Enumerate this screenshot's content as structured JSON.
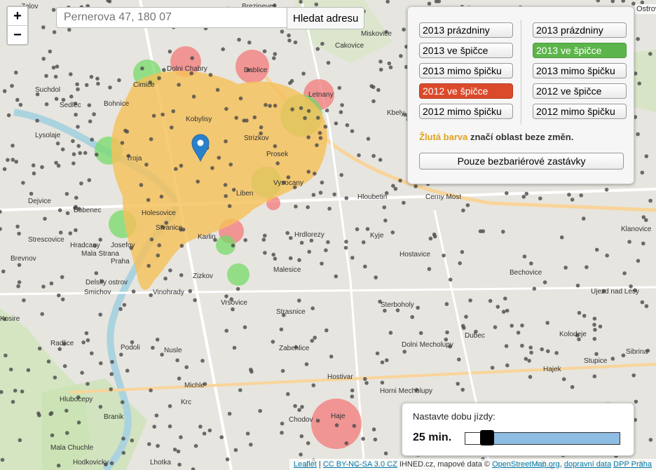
{
  "map": {
    "places": [
      {
        "name": "Zalov"
      },
      {
        "name": "Brezineves"
      },
      {
        "name": "Dolni Chabry"
      },
      {
        "name": "Dablice"
      },
      {
        "name": "Miskovice"
      },
      {
        "name": "Cakovice"
      },
      {
        "name": "Suchdol"
      },
      {
        "name": "Cimice"
      },
      {
        "name": "Letnany"
      },
      {
        "name": "Sedlec"
      },
      {
        "name": "Bohnice"
      },
      {
        "name": "Kobylisy"
      },
      {
        "name": "Kbely"
      },
      {
        "name": "Lysolaje"
      },
      {
        "name": "Strizkov"
      },
      {
        "name": "Troja"
      },
      {
        "name": "Prosek"
      },
      {
        "name": "Vysocany"
      },
      {
        "name": "Dejvice"
      },
      {
        "name": "Liben"
      },
      {
        "name": "Hloubetin"
      },
      {
        "name": "Cerny Most"
      },
      {
        "name": "Bubenec"
      },
      {
        "name": "Holesovice"
      },
      {
        "name": "Stvanice"
      },
      {
        "name": "Karlin"
      },
      {
        "name": "Strescovice"
      },
      {
        "name": "Hradcany"
      },
      {
        "name": "Josefov"
      },
      {
        "name": "Hrdlorezy"
      },
      {
        "name": "Kyje"
      },
      {
        "name": "Klanovice"
      },
      {
        "name": "Mala Strana"
      },
      {
        "name": "Praha"
      },
      {
        "name": "Brevnov"
      },
      {
        "name": "Hostavice"
      },
      {
        "name": "Zizkov"
      },
      {
        "name": "Malesice"
      },
      {
        "name": "Bechovice"
      },
      {
        "name": "Delsky ostrov"
      },
      {
        "name": "Smichov"
      },
      {
        "name": "Vinohrady"
      },
      {
        "name": "Ujezd nad Lesy"
      },
      {
        "name": "Vrsovice"
      },
      {
        "name": "Kosire"
      },
      {
        "name": "Strasnice"
      },
      {
        "name": "Sterboholy"
      },
      {
        "name": "Dubec"
      },
      {
        "name": "Kolodeje"
      },
      {
        "name": "Radlice"
      },
      {
        "name": "Podoli"
      },
      {
        "name": "Zabehlice"
      },
      {
        "name": "Dolni Mecholupy"
      },
      {
        "name": "Nusle"
      },
      {
        "name": "Sibrina"
      },
      {
        "name": "Stupice"
      },
      {
        "name": "Hajek"
      },
      {
        "name": "Michle"
      },
      {
        "name": "Hostivar"
      },
      {
        "name": "Hlubocepy"
      },
      {
        "name": "Krc"
      },
      {
        "name": "Horni Mecholupy"
      },
      {
        "name": "Branik"
      },
      {
        "name": "Chodov"
      },
      {
        "name": "Haje"
      },
      {
        "name": "Mala Chuchle"
      },
      {
        "name": "Lhotka"
      },
      {
        "name": "Hodkovicky"
      }
    ]
  },
  "zoom": {
    "in": "+",
    "out": "−"
  },
  "search": {
    "placeholder": "Pernerova 47, 180 07",
    "button": "Hledat adresu"
  },
  "panel": {
    "left": [
      "2013 prázdniny",
      "2013 ve špičce",
      "2013 mimo špičku",
      "2012 ve špičce",
      "2012 mimo špičku"
    ],
    "right": [
      "2013 prázdniny",
      "2013 ve špičce",
      "2013 mimo špičku",
      "2012 ve špičce",
      "2012 mimo špičku"
    ],
    "legend_yellow": "Žlutá barva",
    "legend_rest": " značí oblast beze změn.",
    "barrier_button": "Pouze bezbariérové zastávky"
  },
  "time": {
    "label": "Nastavte dobu jízdy:",
    "value": "25 min.",
    "fraction": 0.14
  },
  "colors": {
    "selected_green": "#5cb54a",
    "selected_red": "#db4a2b",
    "yellow_area": "#f5c15a",
    "green_area": "#77d96a",
    "red_area": "#f37a7a",
    "slider_fill": "#8ebde3"
  },
  "attribution": {
    "leaflet": "Leaflet",
    "sep": " | ",
    "license": "CC BY-NC-SA 3.0 CZ",
    "text": " IHNED.cz, mapové data © ",
    "osm": "OpenStreetMap.org",
    "comma": ", ",
    "transit": "dopravní data",
    "space": " ",
    "dpp": "DPP Praha"
  },
  "close_label": "Ostrov"
}
